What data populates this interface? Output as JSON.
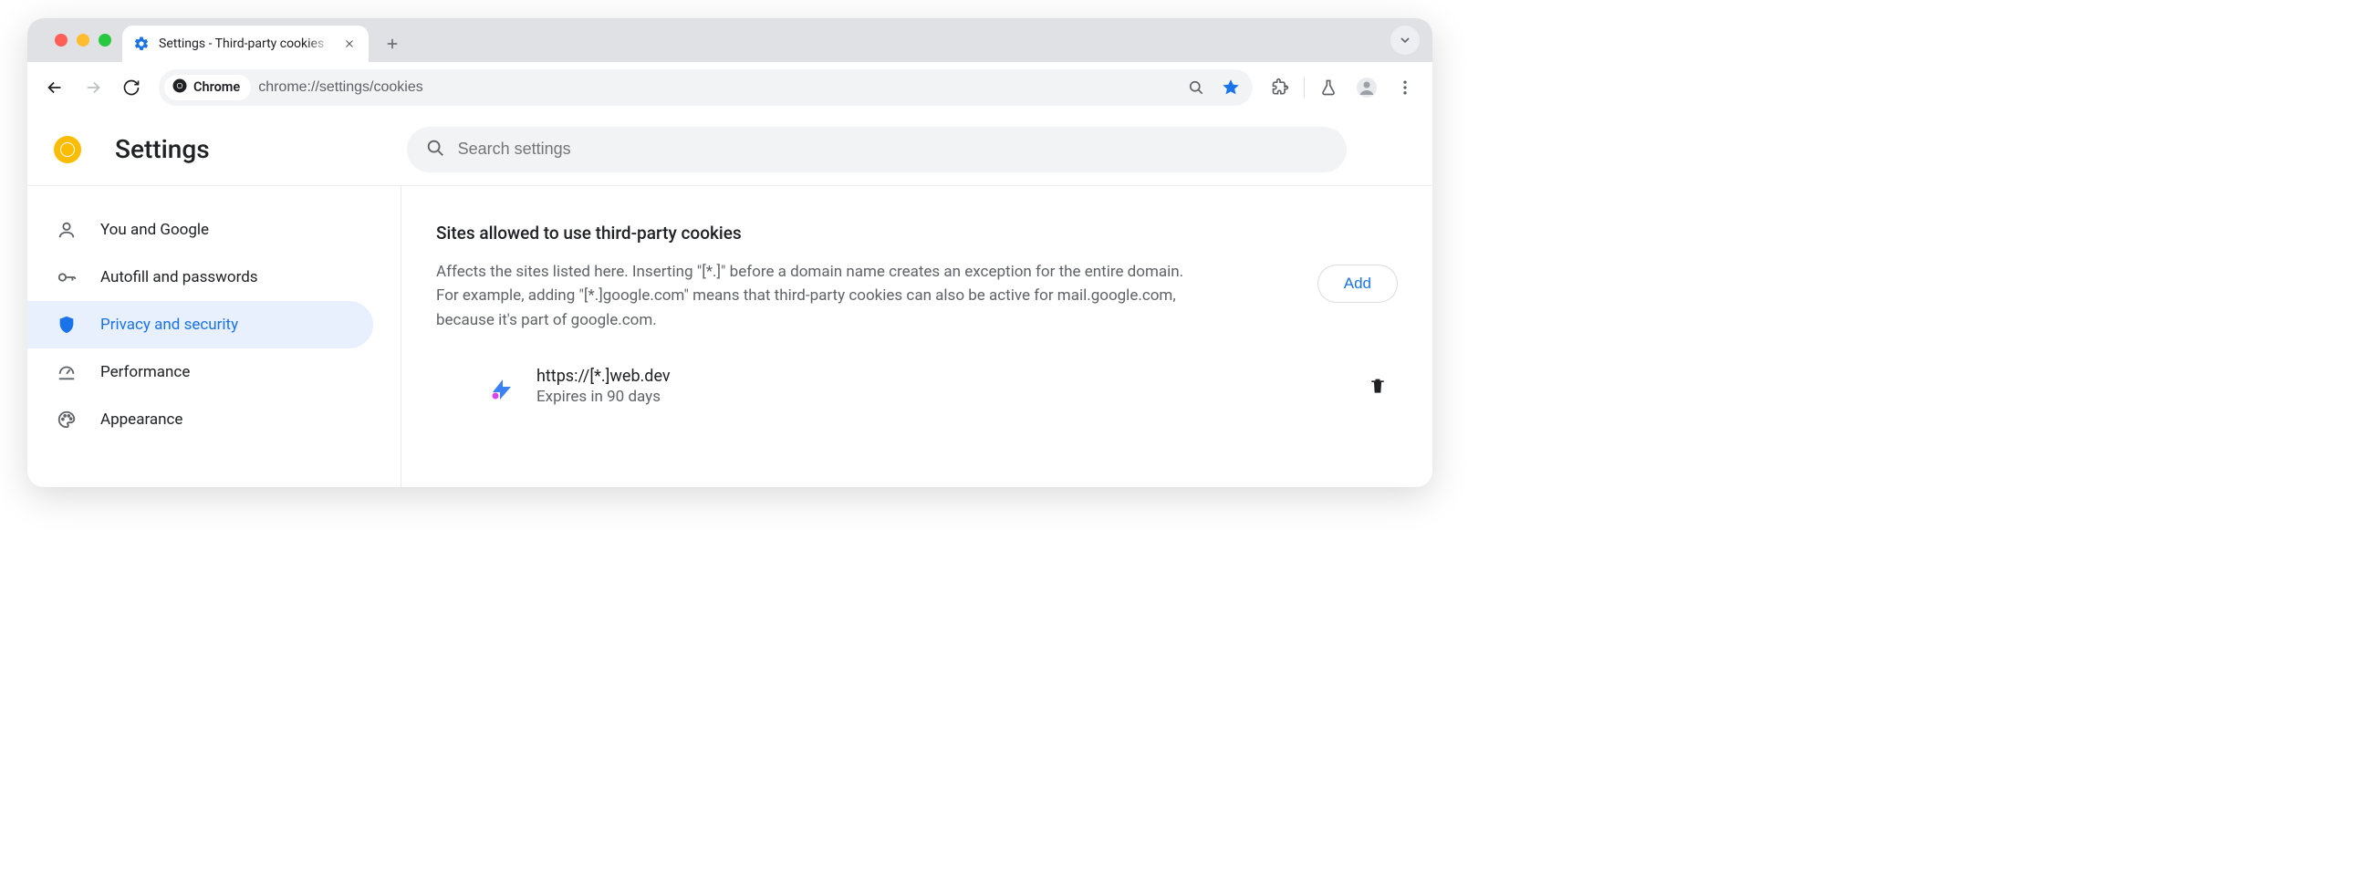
{
  "browser": {
    "tab_title": "Settings - Third-party cookies",
    "omnibox_chip": "Chrome",
    "url": "chrome://settings/cookies"
  },
  "app": {
    "title": "Settings",
    "search_placeholder": "Search settings"
  },
  "sidebar": {
    "items": [
      {
        "label": "You and Google",
        "icon": "person-icon"
      },
      {
        "label": "Autofill and passwords",
        "icon": "key-icon"
      },
      {
        "label": "Privacy and security",
        "icon": "shield-icon"
      },
      {
        "label": "Performance",
        "icon": "speedometer-icon"
      },
      {
        "label": "Appearance",
        "icon": "palette-icon"
      }
    ],
    "active_index": 2
  },
  "section": {
    "title": "Sites allowed to use third-party cookies",
    "description": "Affects the sites listed here. Inserting \"[*.]\" before a domain name creates an exception for the entire domain. For example, adding \"[*.]google.com\" means that third-party cookies can also be active for mail.google.com, because it's part of google.com.",
    "add_label": "Add"
  },
  "sites": [
    {
      "url": "https://[*.]web.dev",
      "expiry": "Expires in 90 days"
    }
  ]
}
